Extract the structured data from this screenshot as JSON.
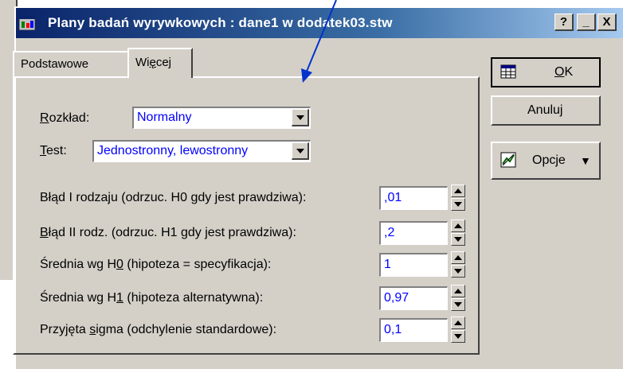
{
  "window": {
    "title": "Plany badań wyrywkowych : dane1 w dodatek03.stw",
    "buttons": {
      "help": "?",
      "minimize": "_",
      "close": "X"
    }
  },
  "tabs": [
    {
      "label": "Podstawowe",
      "active": false
    },
    {
      "label_pre": "Wi",
      "label_ul": "ę",
      "label_post": "cej",
      "active": true
    }
  ],
  "form": {
    "rozklad": {
      "label_ul": "R",
      "label_rest": "ozkład:",
      "value": "Normalny"
    },
    "test": {
      "label_ul": "T",
      "label_rest": "est:",
      "value": "Jednostronny, lewostronny"
    },
    "params": [
      {
        "label_pre": "Błąd I rodza",
        "label_ul": "j",
        "label_post": "u (odrzuc. H0 gdy jest prawdziwa):",
        "value": ",01"
      },
      {
        "label_pre": "",
        "label_ul": "B",
        "label_post": "łąd II rodz. (odrzuc. H1 gdy jest prawdziwa):",
        "value": ",2"
      },
      {
        "label_pre": "Średnia wg H",
        "label_ul": "0",
        "label_post": " (hipoteza = specyfikacja):",
        "value": "1"
      },
      {
        "label_pre": "Średnia wg H",
        "label_ul": "1",
        "label_post": " (hipoteza alternatywna):",
        "value": "0,97"
      },
      {
        "label_pre": "Przyjęta ",
        "label_ul": "s",
        "label_post": "igma (odchylenie standardowe):",
        "value": "0,1"
      }
    ]
  },
  "actions": {
    "ok": {
      "label_ul": "O",
      "label_rest": "K"
    },
    "cancel": {
      "label": "Anuluj"
    },
    "options": {
      "label": "Opcje",
      "arrow": "▼"
    }
  },
  "colors": {
    "title_start": "#0a246a",
    "title_end": "#a6caf0",
    "face": "#d4d0c8",
    "value_text": "#0000ff",
    "annotation": "#0033cc"
  },
  "icons": [
    "window-app-icon",
    "table-icon",
    "options-icon",
    "annotation-arrow"
  ]
}
